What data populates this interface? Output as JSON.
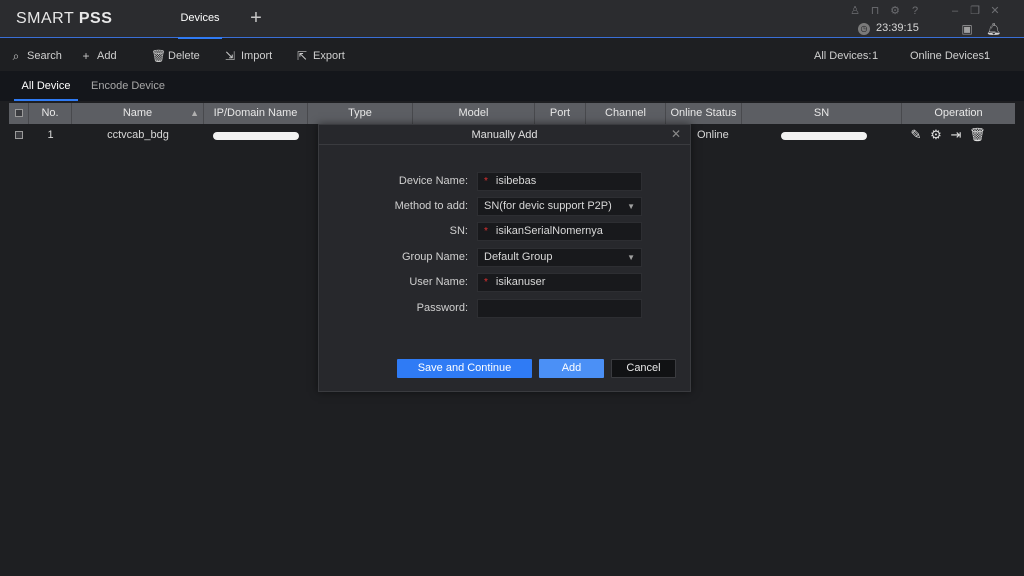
{
  "app": {
    "logo_light": "SMART ",
    "logo_bold": "PSS"
  },
  "titlebar": {
    "active_tab": "Devices",
    "add_tab": "+",
    "clock": "23:39:15"
  },
  "toolbar": {
    "search": "Search",
    "add": "Add",
    "delete": "Delete",
    "import": "Import",
    "export": "Export",
    "all_devices_label": "All Devices:",
    "all_devices_value": "1",
    "online_devices_label": "Online Devices:",
    "online_devices_value": "1"
  },
  "subtabs": {
    "all": "All Device",
    "encode": "Encode Device"
  },
  "table": {
    "headers": {
      "no": "No.",
      "name": "Name",
      "ip": "IP/Domain Name",
      "type": "Type",
      "model": "Model",
      "port": "Port",
      "channel": "Channel Number",
      "status": "Online Status",
      "sn": "SN",
      "operation": "Operation"
    },
    "rows": [
      {
        "no": "1",
        "name": "cctvcab_bdg",
        "status": "Online"
      }
    ]
  },
  "dialog": {
    "title": "Manually Add",
    "device_name_label": "Device Name:",
    "device_name_value": "isibebas",
    "method_label": "Method to add:",
    "method_value": "SN(for devic support P2P)",
    "sn_label": "SN:",
    "sn_value": "isikanSerialNomernya",
    "group_label": "Group Name:",
    "group_value": "Default Group",
    "user_label": "User Name:",
    "user_value": "isikanuser",
    "password_label": "Password:",
    "password_value": "",
    "save_continue": "Save and Continue",
    "add": "Add",
    "cancel": "Cancel",
    "required_mark": "*"
  },
  "colors": {
    "accent": "#2f7bf5",
    "required": "#e03030",
    "background": "#1e1f22"
  }
}
